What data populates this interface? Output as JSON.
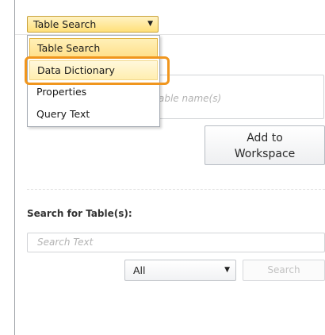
{
  "mode_selector": {
    "value": "Table Search",
    "arrow_icon": "▼"
  },
  "mode_menu": {
    "items": [
      {
        "label": "Table Search",
        "state": "selected"
      },
      {
        "label": "Data Dictionary",
        "state": "hovered"
      },
      {
        "label": "Properties",
        "state": "normal"
      },
      {
        "label": "Query Text",
        "state": "normal"
      }
    ]
  },
  "table_names": {
    "placeholder_visible": "able name(s)"
  },
  "actions": {
    "add_to_workspace_line1": "Add to",
    "add_to_workspace_line2": "Workspace"
  },
  "search": {
    "section_label": "Search for Table(s):",
    "input_placeholder": "Search Text",
    "scope_value": "All",
    "scope_arrow_icon": "▼",
    "search_button": "Search"
  },
  "colors": {
    "highlight_ring": "#f0961e",
    "selected_item": "#ffe08a"
  }
}
